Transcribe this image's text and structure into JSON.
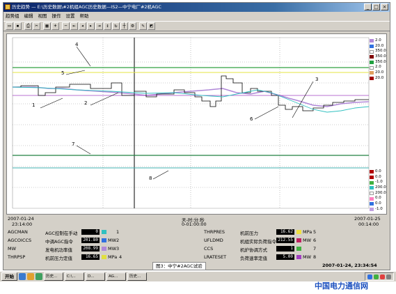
{
  "window": {
    "title": "历史趋势 — E:\\历史数据\\#2机组AGC历史数据—IS2—中宁电厂#2机AGC"
  },
  "menu": [
    "趋势组",
    "编辑",
    "视图",
    "操作",
    "设置",
    "帮助"
  ],
  "toolbar_buttons": [
    "open",
    "save",
    "print",
    "cut",
    "grid",
    "zoom-in",
    "zoom-out",
    "first",
    "prev",
    "next",
    "last",
    "scale",
    "refresh",
    "cursor",
    "tools",
    "pen",
    "eraser"
  ],
  "plot": {
    "time_axis_label": "天-时:分:秒",
    "time_span": "0-01:00:00",
    "start_date": "2007-01-24",
    "start_time": "23:14:00",
    "end_date": "2007-01-25",
    "end_time": "00:14:00",
    "annotations": [
      "1",
      "2",
      "3",
      "4",
      "5",
      "6",
      "7",
      "8"
    ]
  },
  "legend_upper": [
    {
      "value": "2.0",
      "color": "#b088d8"
    },
    {
      "value": "20.0",
      "color": "#3070e0"
    },
    {
      "value": "350.0",
      "color": "#ffffff"
    },
    {
      "value": "350.0",
      "color": "#800000"
    },
    {
      "value": "350.0",
      "color": "#20a040"
    },
    {
      "value": "2.0",
      "color": "#ffffff"
    },
    {
      "value": "20.0",
      "color": "#e0a060"
    },
    {
      "value": "20.0",
      "color": "#a00000"
    }
  ],
  "legend_lower": [
    {
      "value": "0.0",
      "color": "#b00000"
    },
    {
      "value": "0.0",
      "color": "#b00000"
    },
    {
      "value": "-1.0",
      "color": "#40b040"
    },
    {
      "value": "200.0",
      "color": "#30c0c0"
    },
    {
      "value": "200.0",
      "color": "#ffffff"
    },
    {
      "value": "0.0",
      "color": "#ff80c0"
    },
    {
      "value": "0.0",
      "color": "#3070e0"
    },
    {
      "value": "-1.0",
      "color": "#c0a0e0"
    }
  ],
  "tags_left": [
    {
      "tag": "AGCMAN",
      "desc": "AGC控制在手动",
      "value": "0",
      "unit": "",
      "color": "#30c0c0",
      "index": "1"
    },
    {
      "tag": "AGCOICCS",
      "desc": "中调AGC指令",
      "value": "201.80",
      "unit": "MW",
      "color": "#3070e0",
      "index": "2"
    },
    {
      "tag": "MW",
      "desc": "发电机功率值",
      "value": "208.99",
      "unit": "MW",
      "color": "#b088d8",
      "index": "3"
    },
    {
      "tag": "THRPSP",
      "desc": "机前压力定值",
      "value": "16.65",
      "unit": "MPa",
      "color": "#e0e040",
      "index": "4"
    }
  ],
  "tags_right": [
    {
      "tag": "THRPRES",
      "desc": "机前压力",
      "value": "16.62",
      "unit": "MPa",
      "color": "#f0e040",
      "index": "5"
    },
    {
      "tag": "UFLDMD",
      "desc": "机组实际负荷指令",
      "value": "212.55",
      "unit": "MW",
      "color": "#c02060",
      "index": "6"
    },
    {
      "tag": "CCS",
      "desc": "机炉协调方式",
      "value": "1",
      "unit": "",
      "color": "#40b040",
      "index": "7"
    },
    {
      "tag": "LRATESET",
      "desc": "负荷速率定值",
      "value": "5.00",
      "unit": "MW",
      "color": "#a040c0",
      "index": "8"
    }
  ],
  "caption": "图3：中宁#2AGC试验",
  "status_datetime": "2007-01-24, 23:34:54",
  "taskbar": {
    "start_label": "开始",
    "tasks": [
      "历史...",
      "C:\\...",
      "D...",
      "AG...",
      "历史..."
    ]
  },
  "watermark": "中国电力通信网"
}
